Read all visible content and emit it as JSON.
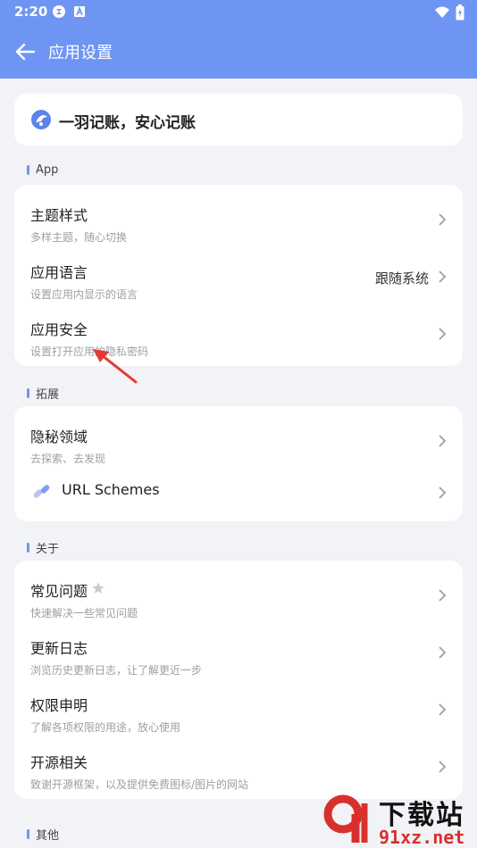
{
  "status": {
    "time": "2:20"
  },
  "appbar": {
    "title": "应用设置"
  },
  "slogan": "一羽记账，安心记账",
  "sections": {
    "app": {
      "label": "App",
      "items": [
        {
          "title": "主题样式",
          "subtitle": "多样主题，随心切换"
        },
        {
          "title": "应用语言",
          "subtitle": "设置应用内显示的语言",
          "value": "跟随系统"
        },
        {
          "title": "应用安全",
          "subtitle": "设置打开应用的隐私密码"
        }
      ]
    },
    "ext": {
      "label": "拓展",
      "items": [
        {
          "title": "隐秘领域",
          "subtitle": "去探索、去发现"
        },
        {
          "title": "URL Schemes"
        }
      ]
    },
    "about": {
      "label": "关于",
      "items": [
        {
          "title": "常见问题",
          "subtitle": "快速解决一些常见问题"
        },
        {
          "title": "更新日志",
          "subtitle": "浏览历史更新日志，让了解更近一步"
        },
        {
          "title": "权限申明",
          "subtitle": "了解各项权限的用途，放心使用"
        },
        {
          "title": "开源相关",
          "subtitle": "致谢开源框架，以及提供免费图标/图片的网站"
        }
      ]
    },
    "other": {
      "label": "其他"
    }
  },
  "watermark": {
    "brand": "下载站",
    "url": "91xz.net"
  },
  "colors": {
    "accent": "#6f95f4",
    "annotation_arrow": "#e53935",
    "watermark_red": "#d8302c"
  }
}
